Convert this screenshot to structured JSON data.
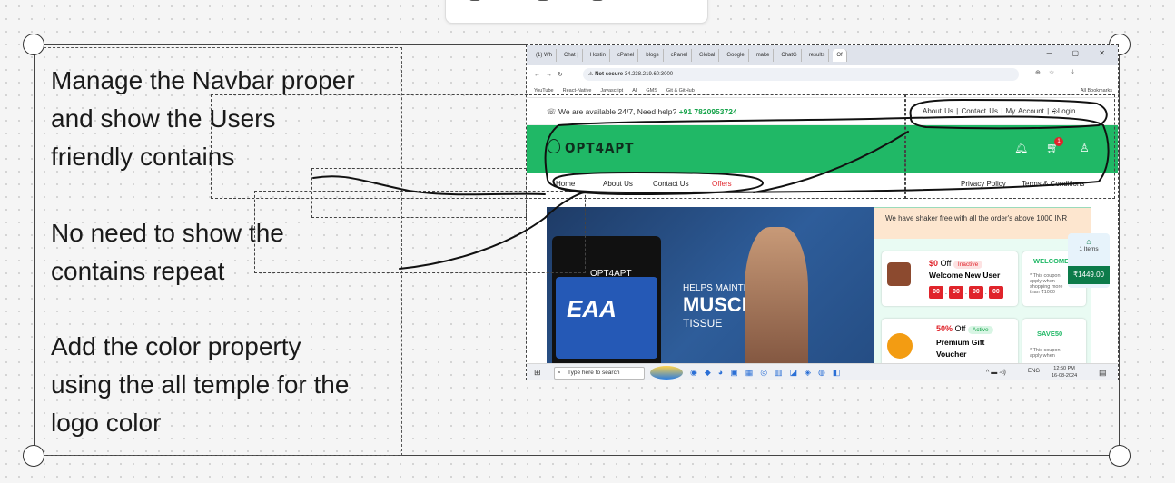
{
  "notes": {
    "note1": [
      "Manage the Navbar proper",
      "and show the Users",
      "friendly contains"
    ],
    "note2": [
      "No need to  show the",
      "contains repeat"
    ],
    "note3": [
      "Add the color property",
      "using the all temple for the",
      "logo color"
    ]
  },
  "browser": {
    "tabs": [
      "(1) Wh",
      "Chat |",
      "Hostin",
      "cPanel",
      "blogs",
      "cPanel",
      "Global",
      "Google",
      "make",
      "ChatG",
      "results",
      "Of"
    ],
    "not_secure": "Not secure",
    "url": "34.238.219.60:3000",
    "bookmarks": [
      "YouTube",
      "React-Native",
      "Javascript",
      "AI",
      "GMS",
      "Git & GitHub"
    ],
    "all_bookmarks": "All Bookmarks"
  },
  "site": {
    "help_prefix": "We are available 24/7, Need help?",
    "phone": "+91 7820953724",
    "top_links": [
      "About Us",
      "Contact Us",
      "My Account",
      "Login"
    ],
    "logo": "OPT4APT",
    "cart_count": "1",
    "nav_left": [
      "Home",
      "About Us",
      "Contact Us",
      "Offers"
    ],
    "nav_right": [
      "Privacy Policy",
      "Terms & Conditions"
    ],
    "hero": {
      "brand": "OPT4APT",
      "product": "EAA",
      "line1": "HELPS MAINTIAN",
      "line2": "MUSCLE",
      "line3": "TISSUE"
    },
    "offers_banner": "We have shaker free with all the order's above 1000 INR",
    "coupon1": {
      "amount": "$0",
      "off": "Off",
      "status": "Inactive",
      "title": "Welcome New User",
      "time": [
        "00",
        "00",
        "00",
        "00"
      ],
      "code": "WELCOME",
      "note": "* This coupon apply when shopping more than ₹1000"
    },
    "coupon2": {
      "amount": "50%",
      "off": "Off",
      "status": "Active",
      "title": "Premium Gift Voucher",
      "code": "SAVE50",
      "note": "* This coupon apply when"
    },
    "side_cart": {
      "items": "1 Items",
      "total": "₹1449.00"
    }
  },
  "taskbar": {
    "search": "Type here to search",
    "lang": "ENG",
    "time": "12:50 PM",
    "date": "16-08-2024"
  },
  "colors": {
    "brand_green": "#20b866",
    "ink_dark": "#0f2d1d",
    "phone_green": "#16a34a",
    "timer_red": "#e0242b"
  }
}
